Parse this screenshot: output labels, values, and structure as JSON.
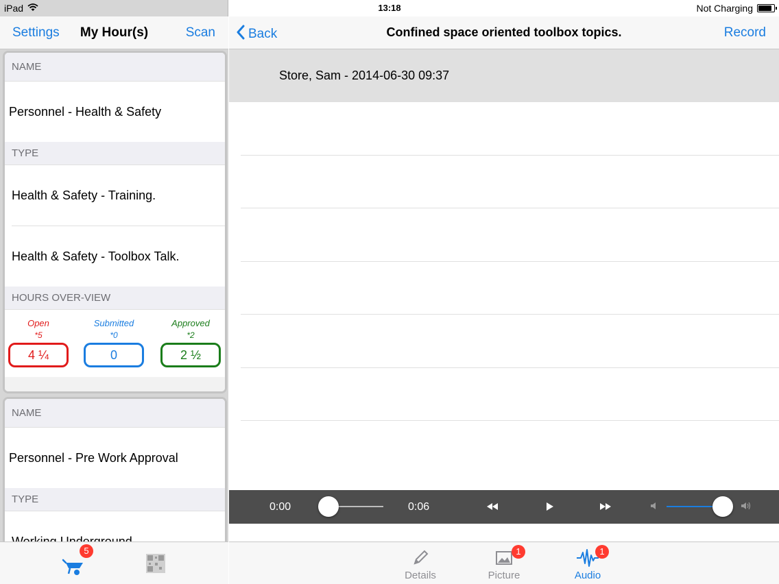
{
  "status_bar": {
    "device": "iPad",
    "time": "13:18",
    "battery_text": "Not Charging"
  },
  "left": {
    "nav": {
      "settings": "Settings",
      "title": "My Hour(s)",
      "scan": "Scan"
    },
    "cards": [
      {
        "name_header": "NAME",
        "name": "Personnel - Health & Safety",
        "type_header": "TYPE",
        "types": [
          "Health & Safety - Training.",
          "Health & Safety - Toolbox Talk."
        ],
        "overview_header": "HOURS OVER-VIEW",
        "overview": [
          {
            "label": "Open",
            "count": "*5",
            "value": "4 ¼",
            "color": "#e11b1b"
          },
          {
            "label": "Submitted",
            "count": "*0",
            "value": "0",
            "color": "#1a7de0"
          },
          {
            "label": "Approved",
            "count": "*2",
            "value": "2 ½",
            "color": "#1a7d1a"
          }
        ]
      },
      {
        "name_header": "NAME",
        "name": "Personnel - Pre Work Approval",
        "type_header": "TYPE",
        "types": [
          "Working Underground"
        ]
      }
    ],
    "tabbar": {
      "wheelbarrow_badge": "5",
      "icons": [
        "wheelbarrow-icon",
        "qr-code-icon"
      ]
    }
  },
  "right": {
    "nav": {
      "back": "Back",
      "title": "Confined space oriented toolbox topics.",
      "record": "Record"
    },
    "recording": "Store, Sam - 2014-06-30 09:37",
    "player": {
      "elapsed": "0:00",
      "duration": "0:06",
      "progress": 0.0,
      "volume": 0.85
    },
    "tabs": [
      {
        "label": "Details",
        "icon": "pencil-icon",
        "badge": "",
        "active": false
      },
      {
        "label": "Picture",
        "icon": "picture-icon",
        "badge": "1",
        "active": false
      },
      {
        "label": "Audio",
        "icon": "audio-wave-icon",
        "badge": "1",
        "active": true
      }
    ]
  },
  "colors": {
    "accent": "#1a7de0",
    "badge": "#ff3b30",
    "player_bg": "#4d4d4d"
  }
}
